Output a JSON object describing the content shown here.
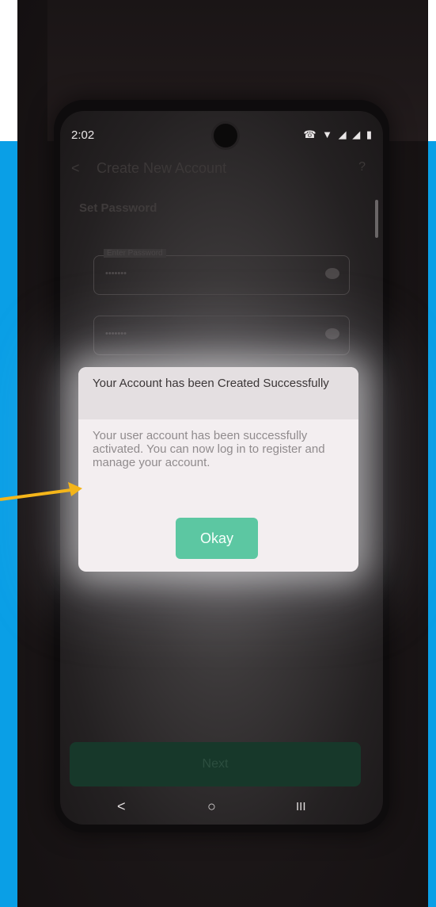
{
  "status_bar": {
    "time": "2:02",
    "icons": "☎ ▼ ◢ ◢ ▮"
  },
  "background_screen": {
    "header_title": "Create New Account",
    "back_glyph": "<",
    "help_glyph": "?",
    "section_title": "Set Password",
    "fields": [
      {
        "label": "Enter Password",
        "value": "•••••••"
      },
      {
        "label": "",
        "value": "•••••••"
      }
    ],
    "next_label": "Next"
  },
  "dialog": {
    "title": "Your Account has been Created Successfully",
    "message": "Your user account has been successfully activated. You can now log in to register and manage your account.",
    "okay_label": "Okay"
  },
  "nav_bar": {
    "back": "<",
    "home": "○",
    "recents": "III"
  },
  "colors": {
    "frame_blue": "#0a9fe6",
    "accent_green": "#5cc7a2",
    "arrow_orange": "#f4b51a"
  }
}
